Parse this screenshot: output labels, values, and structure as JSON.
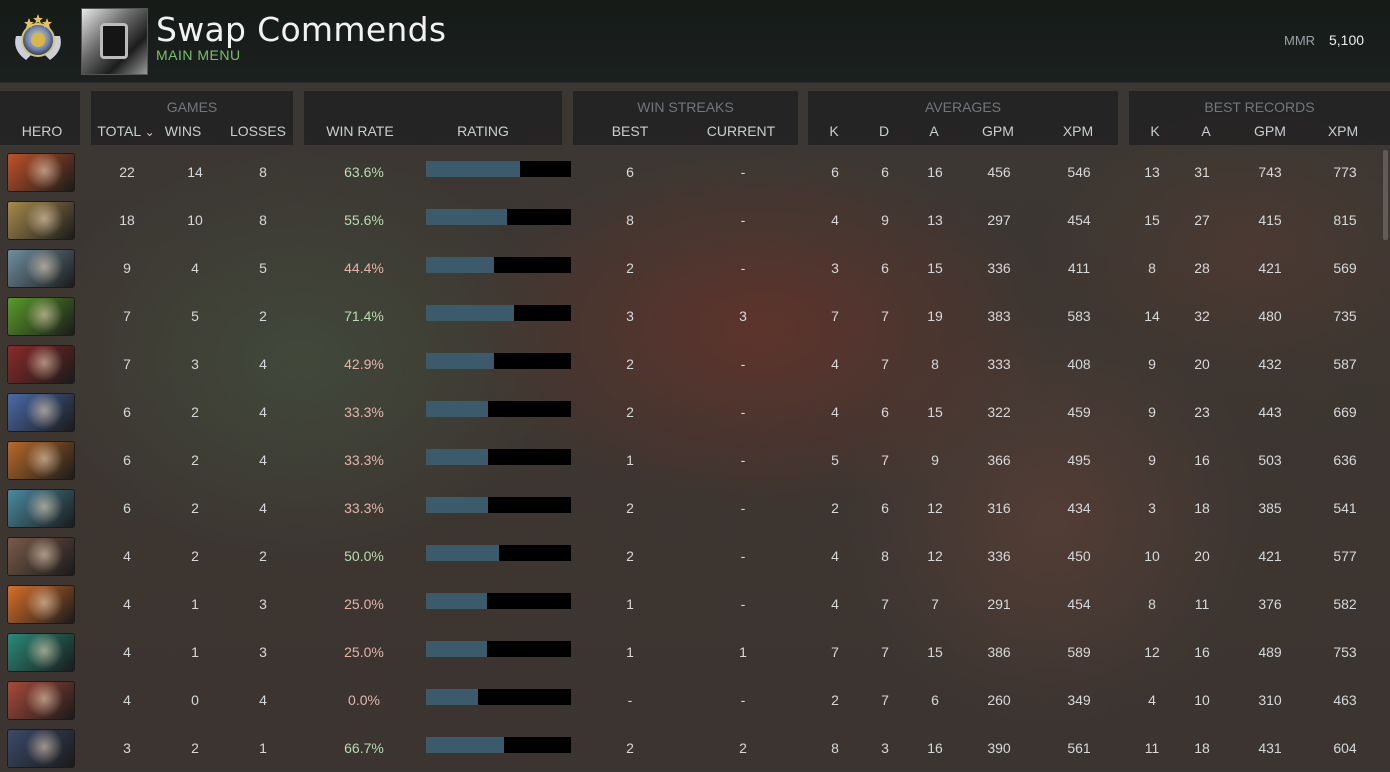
{
  "profile": {
    "player_name": "Swap Commends",
    "main_menu_label": "MAIN MENU",
    "mmr_label": "MMR",
    "mmr_value": "5,100",
    "rank_icon": "rank-medal-icon",
    "avatar_icon": "player-avatar"
  },
  "table": {
    "groups": {
      "games": "GAMES",
      "win_streaks": "WIN STREAKS",
      "averages": "AVERAGES",
      "best_records": "BEST RECORDS"
    },
    "columns": {
      "hero": "HERO",
      "total": "TOTAL",
      "sort_indicator": "⌄",
      "wins": "WINS",
      "losses": "LOSSES",
      "win_rate": "WIN RATE",
      "rating": "RATING",
      "best": "BEST",
      "current": "CURRENT",
      "avg_k": "K",
      "avg_d": "D",
      "avg_a": "A",
      "avg_gpm": "GPM",
      "avg_xpm": "XPM",
      "best_k": "K",
      "best_a": "A",
      "best_gpm": "GPM",
      "best_xpm": "XPM"
    },
    "colors": {
      "win_rate_high": "#b9dcb0",
      "win_rate_low": "#e4b4ab",
      "rating_fill": "#3b5a6c",
      "rating_empty": "#000000"
    },
    "rows": [
      {
        "hero_color": "#c0522a",
        "total": "22",
        "wins": "14",
        "losses": "8",
        "win_rate": "63.6%",
        "rating": 0.65,
        "best": "6",
        "current": "-",
        "k": "6",
        "d": "6",
        "a": "16",
        "gpm": "456",
        "xpm": "546",
        "bk": "13",
        "ba": "31",
        "bgpm": "743",
        "bxpm": "773"
      },
      {
        "hero_color": "#a88a4e",
        "total": "18",
        "wins": "10",
        "losses": "8",
        "win_rate": "55.6%",
        "rating": 0.56,
        "best": "8",
        "current": "-",
        "k": "4",
        "d": "9",
        "a": "13",
        "gpm": "297",
        "xpm": "454",
        "bk": "15",
        "ba": "27",
        "bgpm": "415",
        "bxpm": "815"
      },
      {
        "hero_color": "#6f8fa0",
        "total": "9",
        "wins": "4",
        "losses": "5",
        "win_rate": "44.4%",
        "rating": 0.47,
        "best": "2",
        "current": "-",
        "k": "3",
        "d": "6",
        "a": "15",
        "gpm": "336",
        "xpm": "411",
        "bk": "8",
        "ba": "28",
        "bgpm": "421",
        "bxpm": "569"
      },
      {
        "hero_color": "#5a9a2a",
        "total": "7",
        "wins": "5",
        "losses": "2",
        "win_rate": "71.4%",
        "rating": 0.61,
        "best": "3",
        "current": "3",
        "k": "7",
        "d": "7",
        "a": "19",
        "gpm": "383",
        "xpm": "583",
        "bk": "14",
        "ba": "32",
        "bgpm": "480",
        "bxpm": "735"
      },
      {
        "hero_color": "#8a2a2a",
        "total": "7",
        "wins": "3",
        "losses": "4",
        "win_rate": "42.9%",
        "rating": 0.47,
        "best": "2",
        "current": "-",
        "k": "4",
        "d": "7",
        "a": "8",
        "gpm": "333",
        "xpm": "408",
        "bk": "9",
        "ba": "20",
        "bgpm": "432",
        "bxpm": "587"
      },
      {
        "hero_color": "#4a6aa8",
        "total": "6",
        "wins": "2",
        "losses": "4",
        "win_rate": "33.3%",
        "rating": 0.43,
        "best": "2",
        "current": "-",
        "k": "4",
        "d": "6",
        "a": "15",
        "gpm": "322",
        "xpm": "459",
        "bk": "9",
        "ba": "23",
        "bgpm": "443",
        "bxpm": "669"
      },
      {
        "hero_color": "#b86a2a",
        "total": "6",
        "wins": "2",
        "losses": "4",
        "win_rate": "33.3%",
        "rating": 0.43,
        "best": "1",
        "current": "-",
        "k": "5",
        "d": "7",
        "a": "9",
        "gpm": "366",
        "xpm": "495",
        "bk": "9",
        "ba": "16",
        "bgpm": "503",
        "bxpm": "636"
      },
      {
        "hero_color": "#4a8aa0",
        "total": "6",
        "wins": "2",
        "losses": "4",
        "win_rate": "33.3%",
        "rating": 0.43,
        "best": "2",
        "current": "-",
        "k": "2",
        "d": "6",
        "a": "12",
        "gpm": "316",
        "xpm": "434",
        "bk": "3",
        "ba": "18",
        "bgpm": "385",
        "bxpm": "541"
      },
      {
        "hero_color": "#7a5a4a",
        "total": "4",
        "wins": "2",
        "losses": "2",
        "win_rate": "50.0%",
        "rating": 0.5,
        "best": "2",
        "current": "-",
        "k": "4",
        "d": "8",
        "a": "12",
        "gpm": "336",
        "xpm": "450",
        "bk": "10",
        "ba": "20",
        "bgpm": "421",
        "bxpm": "577"
      },
      {
        "hero_color": "#d8702a",
        "total": "4",
        "wins": "1",
        "losses": "3",
        "win_rate": "25.0%",
        "rating": 0.42,
        "best": "1",
        "current": "-",
        "k": "4",
        "d": "7",
        "a": "7",
        "gpm": "291",
        "xpm": "454",
        "bk": "8",
        "ba": "11",
        "bgpm": "376",
        "bxpm": "582"
      },
      {
        "hero_color": "#2a8a7a",
        "total": "4",
        "wins": "1",
        "losses": "3",
        "win_rate": "25.0%",
        "rating": 0.42,
        "best": "1",
        "current": "1",
        "k": "7",
        "d": "7",
        "a": "15",
        "gpm": "386",
        "xpm": "589",
        "bk": "12",
        "ba": "16",
        "bgpm": "489",
        "bxpm": "753"
      },
      {
        "hero_color": "#a84a3a",
        "total": "4",
        "wins": "0",
        "losses": "4",
        "win_rate": "0.0%",
        "rating": 0.36,
        "best": "-",
        "current": "-",
        "k": "2",
        "d": "7",
        "a": "6",
        "gpm": "260",
        "xpm": "349",
        "bk": "4",
        "ba": "10",
        "bgpm": "310",
        "bxpm": "463"
      },
      {
        "hero_color": "#3a4a6a",
        "total": "3",
        "wins": "2",
        "losses": "1",
        "win_rate": "66.7%",
        "rating": 0.54,
        "best": "2",
        "current": "2",
        "k": "8",
        "d": "3",
        "a": "16",
        "gpm": "390",
        "xpm": "561",
        "bk": "11",
        "ba": "18",
        "bgpm": "431",
        "bxpm": "604"
      }
    ]
  }
}
